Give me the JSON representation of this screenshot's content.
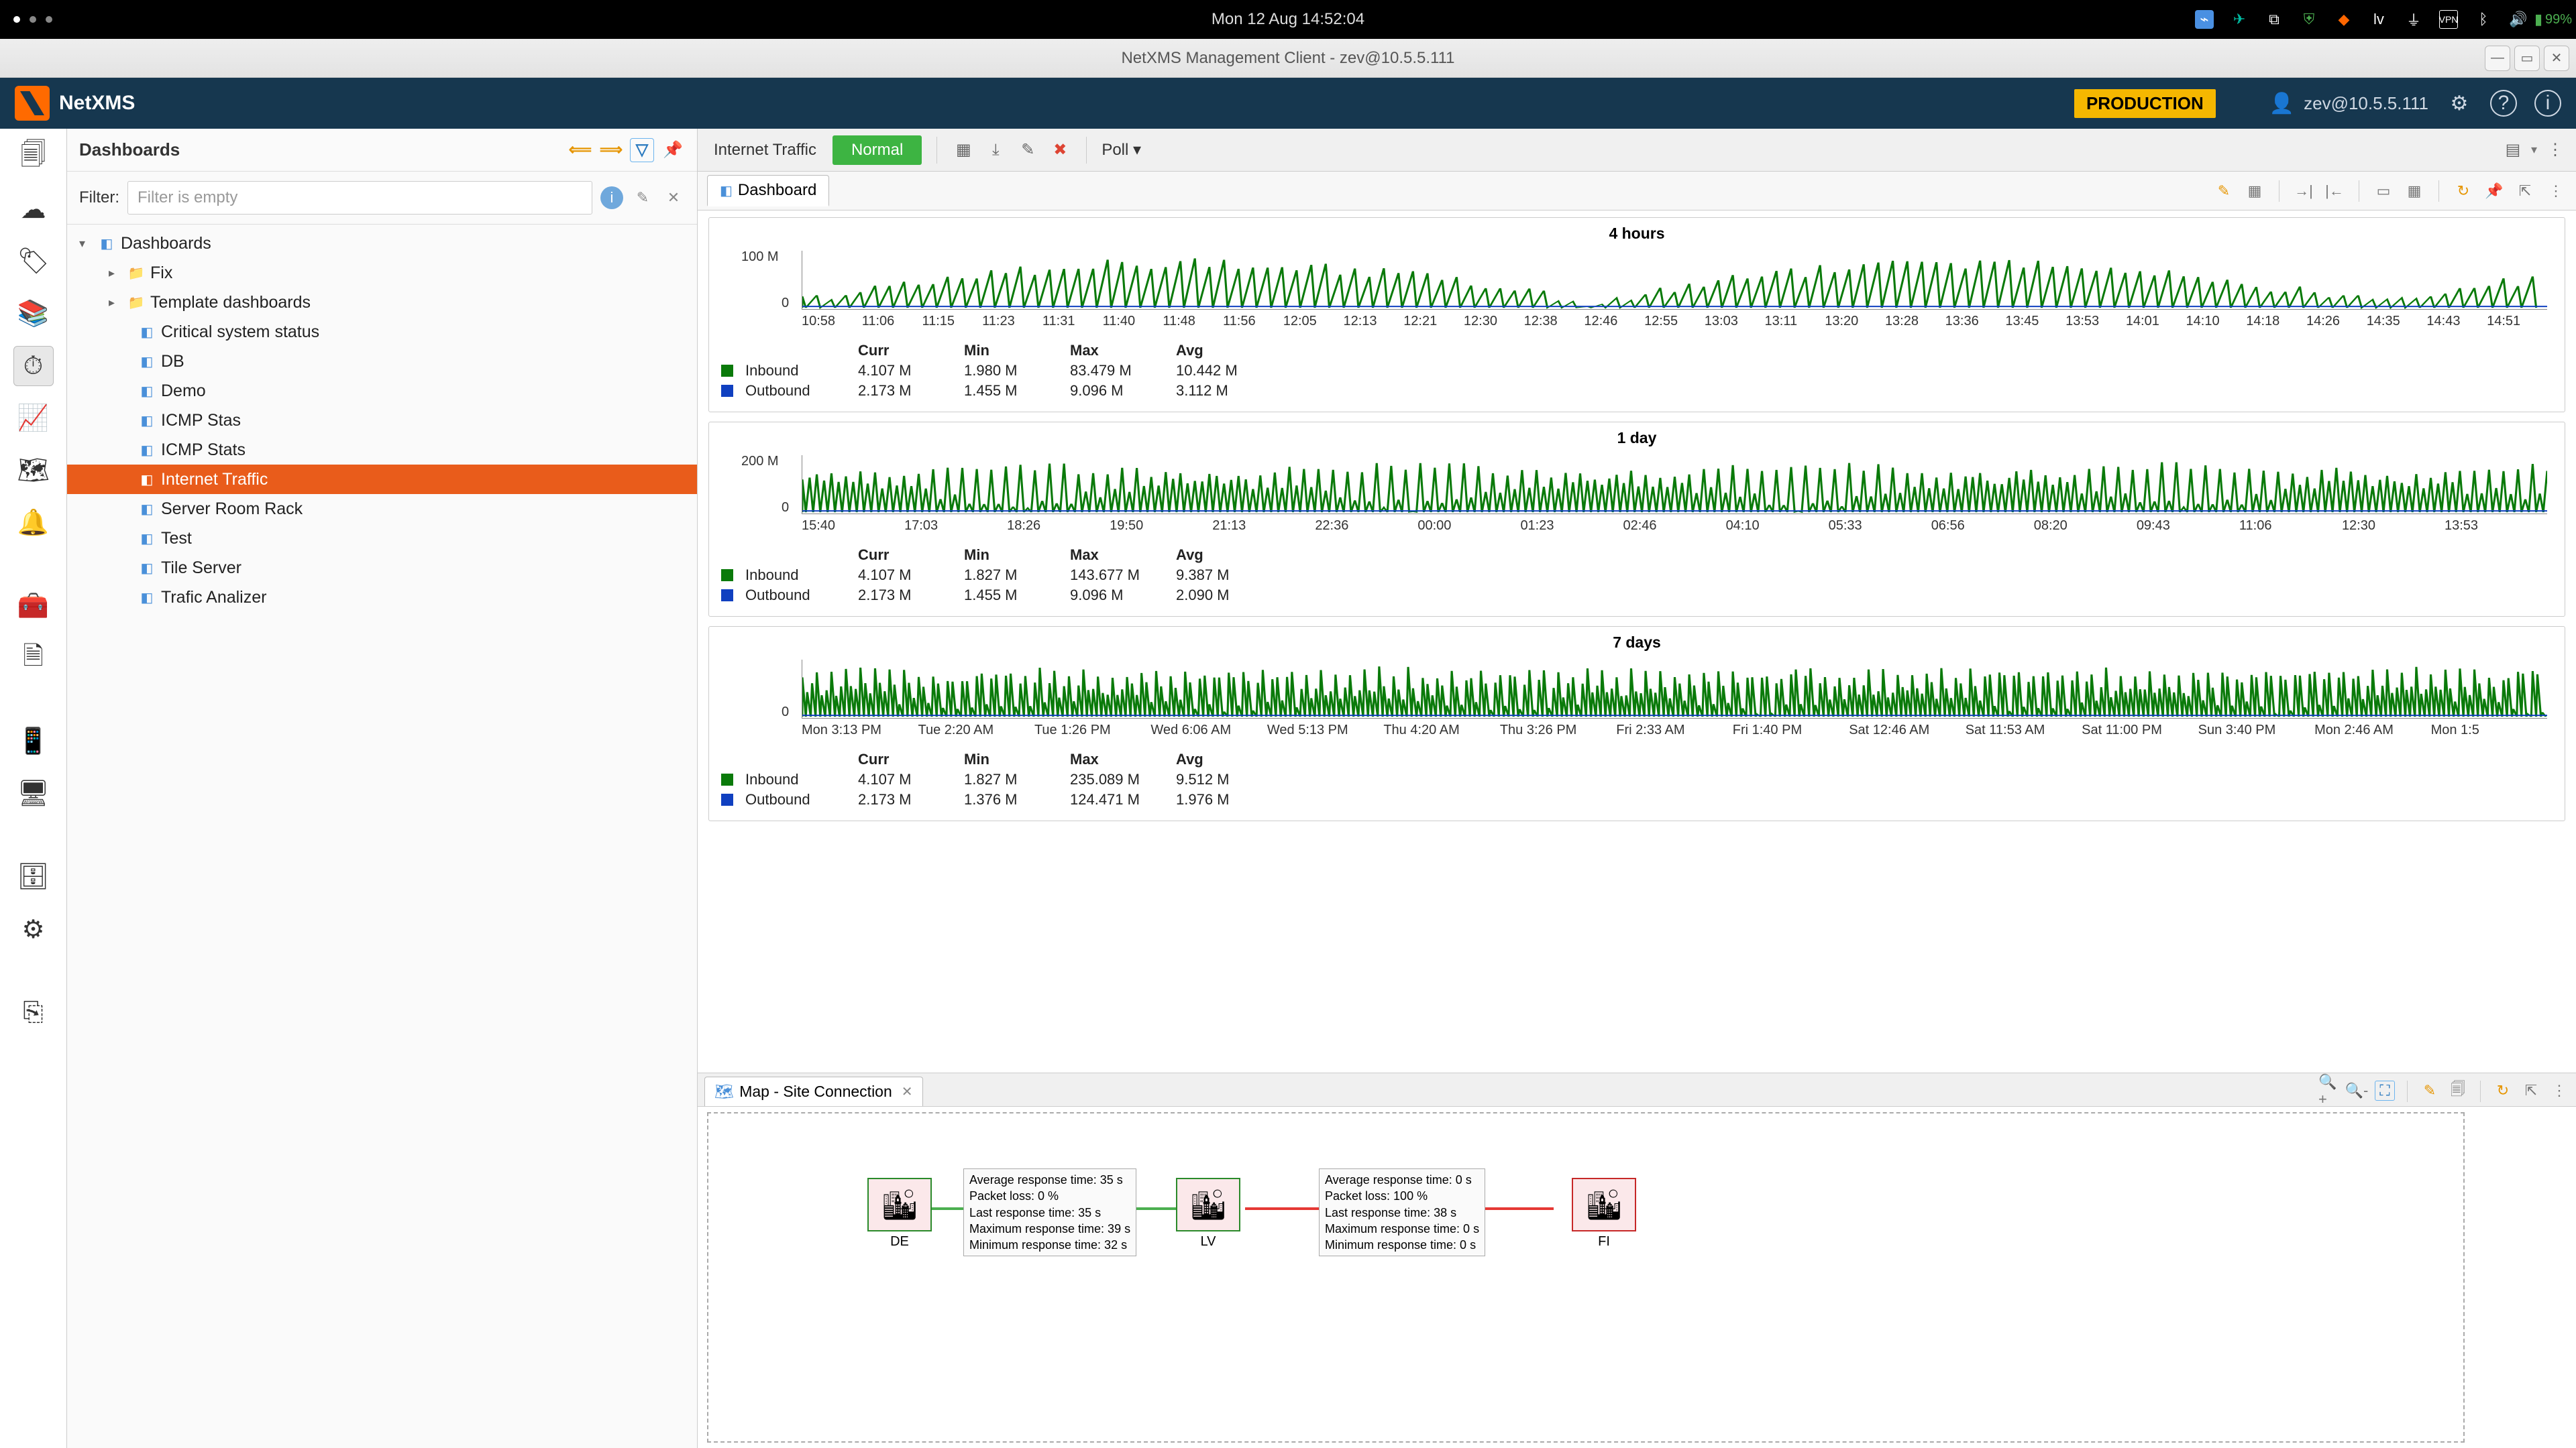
{
  "os": {
    "clock": "Mon 12 Aug  14:52:04",
    "battery": "99%",
    "tray_lang": "lv"
  },
  "window": {
    "title": "NetXMS Management Client - zev@10.5.5.111"
  },
  "app": {
    "brand": "NetXMS",
    "env_badge": "PRODUCTION",
    "user": "zev@10.5.5.111"
  },
  "sidebar": {
    "title": "Dashboards",
    "filter_label": "Filter:",
    "filter_placeholder": "Filter is empty",
    "root": "Dashboards",
    "fix": "Fix",
    "template": "Template dashboards",
    "items": [
      "Critical system status",
      "DB",
      "Demo",
      "ICMP Stas",
      "ICMP Stats",
      "Internet Traffic",
      "Server Room Rack",
      "Test",
      "Tile Server",
      "Trafic Analizer"
    ],
    "selected": "Internet Traffic"
  },
  "tabbar": {
    "tab": "Internet Traffic",
    "status": "Normal",
    "poll": "Poll ▾"
  },
  "subtab": {
    "label": "Dashboard"
  },
  "legend_headers": {
    "curr": "Curr",
    "min": "Min",
    "max": "Max",
    "avg": "Avg"
  },
  "series_names": {
    "in": "Inbound",
    "out": "Outbound"
  },
  "chart_data": [
    {
      "type": "line",
      "title": "4 hours",
      "ylabels": [
        "100 M",
        "0"
      ],
      "xlabels": [
        "10:58",
        "11:06",
        "11:15",
        "11:23",
        "11:31",
        "11:40",
        "11:48",
        "11:56",
        "12:05",
        "12:13",
        "12:21",
        "12:30",
        "12:38",
        "12:46",
        "12:55",
        "13:03",
        "13:11",
        "13:20",
        "13:28",
        "13:36",
        "13:45",
        "13:53",
        "14:01",
        "14:10",
        "14:18",
        "14:26",
        "14:35",
        "14:43",
        "14:51"
      ],
      "legend": {
        "in": {
          "curr": "4.107 M",
          "min": "1.980 M",
          "max": "83.479 M",
          "avg": "10.442 M"
        },
        "out": {
          "curr": "2.173 M",
          "min": "1.455 M",
          "max": "9.096 M",
          "avg": "3.112 M"
        }
      }
    },
    {
      "type": "line",
      "title": "1 day",
      "ylabels": [
        "200 M",
        "0"
      ],
      "xlabels": [
        "15:40",
        "17:03",
        "18:26",
        "19:50",
        "21:13",
        "22:36",
        "00:00",
        "01:23",
        "02:46",
        "04:10",
        "05:33",
        "06:56",
        "08:20",
        "09:43",
        "11:06",
        "12:30",
        "13:53"
      ],
      "legend": {
        "in": {
          "curr": "4.107 M",
          "min": "1.827 M",
          "max": "143.677 M",
          "avg": "9.387 M"
        },
        "out": {
          "curr": "2.173 M",
          "min": "1.455 M",
          "max": "9.096 M",
          "avg": "2.090 M"
        }
      }
    },
    {
      "type": "line",
      "title": "7 days",
      "ylabels": [
        "",
        "0"
      ],
      "xlabels": [
        "Mon 3:13 PM",
        "Tue 2:20 AM",
        "Tue 1:26 PM",
        "Wed 6:06 AM",
        "Wed 5:13 PM",
        "Thu 4:20 AM",
        "Thu 3:26 PM",
        "Fri 2:33 AM",
        "Fri 1:40 PM",
        "Sat 12:46 AM",
        "Sat 11:53 AM",
        "Sat 11:00 PM",
        "Sun 3:40 PM",
        "Mon 2:46 AM",
        "Mon 1:5"
      ],
      "legend": {
        "in": {
          "curr": "4.107 M",
          "min": "1.827 M",
          "max": "235.089 M",
          "avg": "9.512 M"
        },
        "out": {
          "curr": "2.173 M",
          "min": "1.376 M",
          "max": "124.471 M",
          "avg": "1.976 M"
        }
      }
    }
  ],
  "map": {
    "tab_label": "Map - Site Connection",
    "nodes": {
      "de": "DE",
      "lv": "LV",
      "fi": "FI"
    },
    "link_de_lv": {
      "l1": "Average response time: 35 s",
      "l2": "Packet loss: 0 %",
      "l3": "Last response time: 35 s",
      "l4": "Maximum response time: 39 s",
      "l5": "Minimum response time: 32 s"
    },
    "link_lv_fi": {
      "l1": "Average response time: 0 s",
      "l2": "Packet loss: 100 %",
      "l3": "Last response time: 38 s",
      "l4": "Maximum response time: 0 s",
      "l5": "Minimum response time: 0 s"
    }
  }
}
